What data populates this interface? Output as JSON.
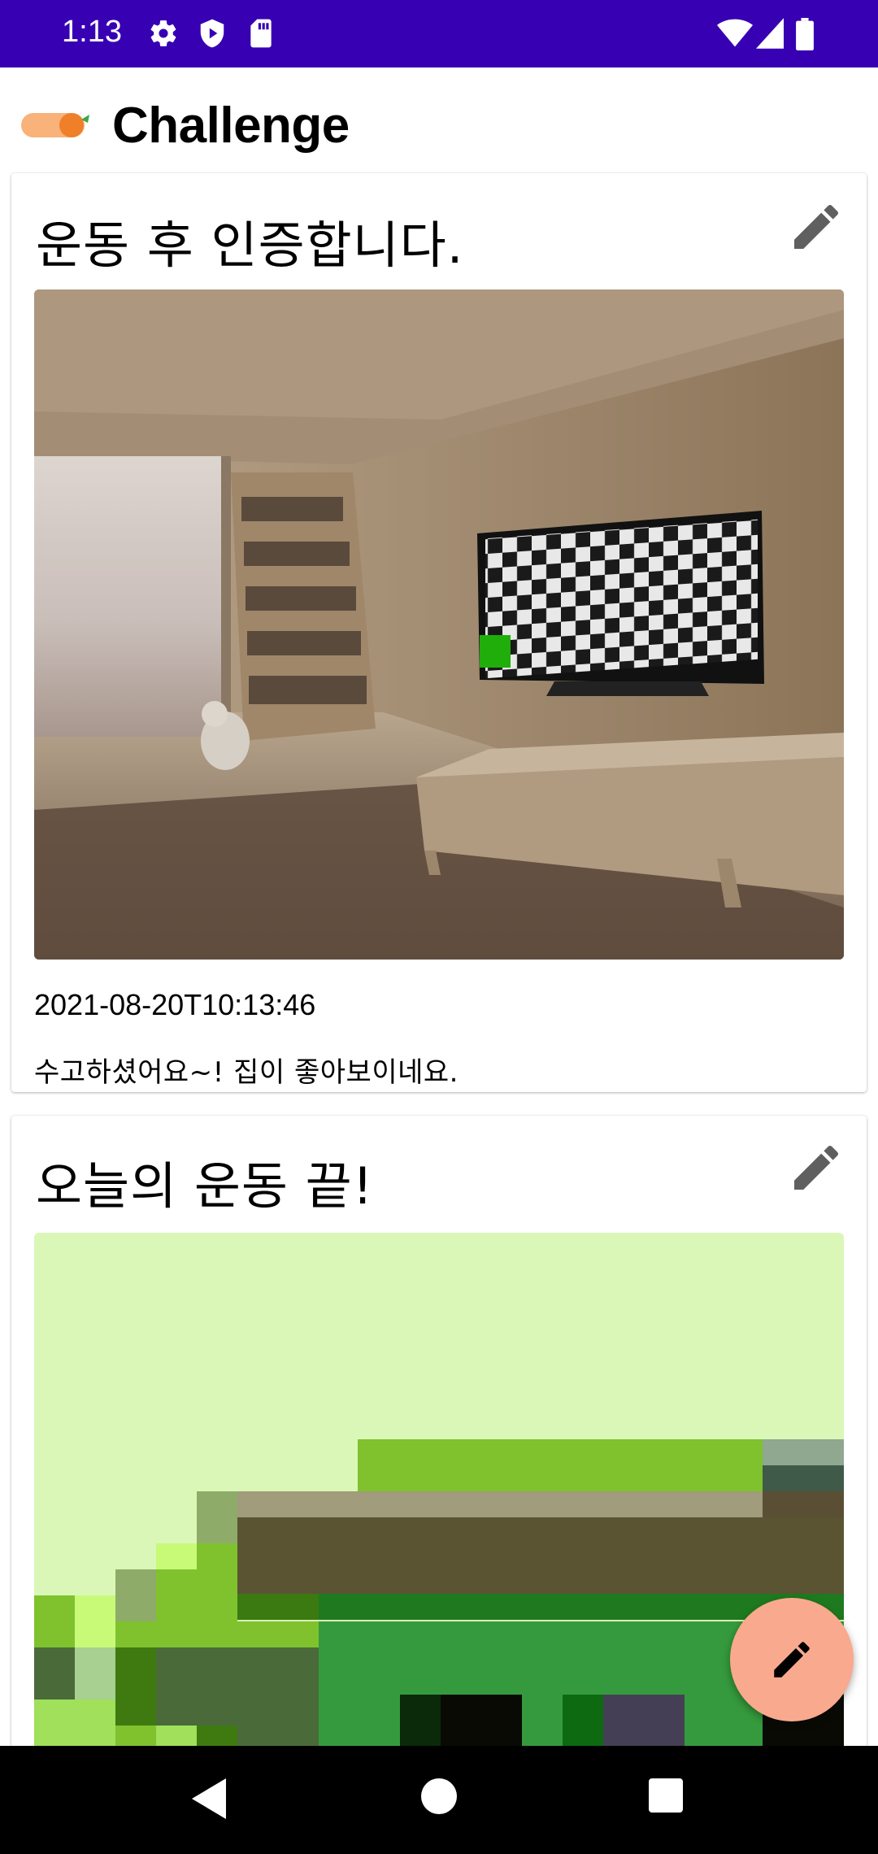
{
  "status_bar": {
    "time": "1:13",
    "left_icons": [
      "gear-icon",
      "shield-icon",
      "sd-card-icon"
    ],
    "right_icons": [
      "wifi-icon",
      "signal-icon",
      "battery-icon"
    ]
  },
  "app_bar": {
    "title": "Challenge",
    "logo": "carrot-logo"
  },
  "posts": [
    {
      "title": "운동 후 인증합니다.",
      "date": "2021-08-20T10:13:46",
      "body": "수고하셨어요~! 집이 좋아보이네요.",
      "image": "room-with-tv-photo"
    },
    {
      "title": "오늘의 운동 끝!",
      "image": "pixelated-green-image"
    }
  ],
  "fab": {
    "icon": "pencil-icon"
  },
  "colors": {
    "status_bar": "#3700b3",
    "fab": "#f9a98e",
    "nav_bar": "#000000"
  }
}
